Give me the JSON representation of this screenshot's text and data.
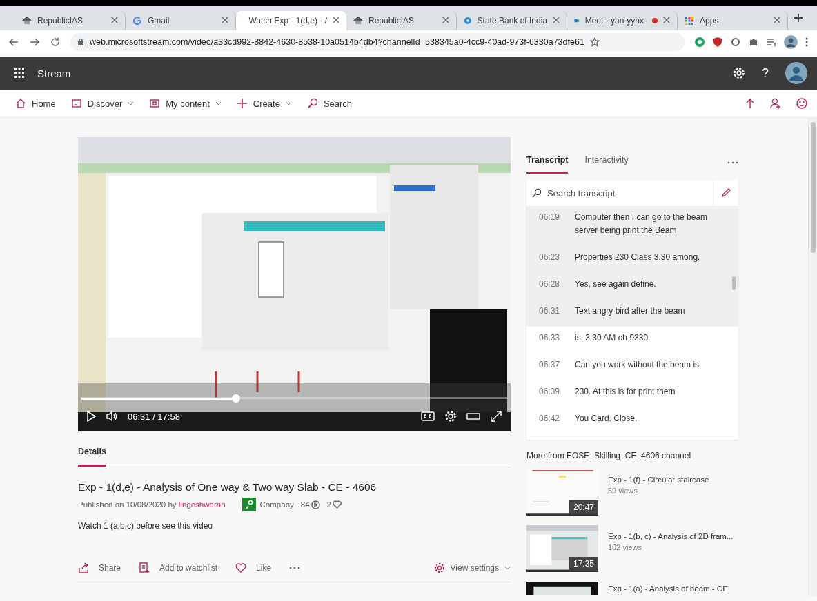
{
  "browser": {
    "tabs": [
      {
        "title": "RepublicIAS",
        "kind": "republic",
        "selected": false,
        "recording": false
      },
      {
        "title": "Gmail",
        "kind": "gmail",
        "selected": false,
        "recording": false
      },
      {
        "title": "Watch Exp - 1(d,e) - /",
        "kind": "stream",
        "selected": true,
        "recording": false
      },
      {
        "title": "RepublicIAS",
        "kind": "republic",
        "selected": false,
        "recording": false
      },
      {
        "title": "State Bank of India",
        "kind": "sbi",
        "selected": false,
        "recording": false
      },
      {
        "title": "Meet - yan-yyhx-",
        "kind": "meet",
        "selected": false,
        "recording": true
      },
      {
        "title": "Apps",
        "kind": "apps",
        "selected": false,
        "recording": false
      }
    ],
    "url": "web.microsoftstream.com/video/a33cd992-8842-4630-8538-10a0514b4db4?channelId=538345a0-4cc9-40ad-973f-6330a73dfe61"
  },
  "app": {
    "name": "Stream",
    "help": "?"
  },
  "nav": [
    {
      "label": "Home",
      "kind": "home",
      "dropdown": false
    },
    {
      "label": "Discover",
      "kind": "discover",
      "dropdown": true
    },
    {
      "label": "My content",
      "kind": "content",
      "dropdown": true
    },
    {
      "label": "Create",
      "kind": "create",
      "dropdown": true
    },
    {
      "label": "Search",
      "kind": "search",
      "dropdown": false
    }
  ],
  "player": {
    "progress": {
      "level": 0.363
    },
    "time": "06:31 / 17:58"
  },
  "transcript": {
    "tabs": [
      {
        "label": "Transcript",
        "selected": true
      },
      {
        "label": "Interactivity",
        "selected": false
      }
    ],
    "search": {
      "placeholder": "Search transcript"
    },
    "lines": [
      {
        "time": "06:19",
        "text": "Computer then I can go to the beam server being print the Beam",
        "highlighted": true
      },
      {
        "time": "06:23",
        "text": "Properties 230 Class 3.30 among.",
        "highlighted": true
      },
      {
        "time": "06:28",
        "text": "Yes, see again define.",
        "highlighted": true
      },
      {
        "time": "06:31",
        "text": "Text angry bird after the beam",
        "highlighted": true
      },
      {
        "time": "06:33",
        "text": "is. 3:30 AM oh 9330.",
        "highlighted": false
      },
      {
        "time": "06:37",
        "text": "Can you work without the beam is",
        "highlighted": false
      },
      {
        "time": "06:39",
        "text": "230. At this is for print them",
        "highlighted": false
      },
      {
        "time": "06:42",
        "text": "You Card. Close.",
        "highlighted": false
      }
    ]
  },
  "details": {
    "tabs": [
      {
        "label": "Details",
        "selected": true
      }
    ],
    "title": "Exp - 1(d,e) - Analysis of One way & Two way Slab - CE - 4606",
    "published": "Published on 10/08/2020 by",
    "author": "lingeshwaran",
    "privacy": "Company",
    "views": "84",
    "likes": "2",
    "description": "Watch 1 (a,b,c) before see this video",
    "actions": [
      {
        "label": "Share",
        "kind": "share"
      },
      {
        "label": "Add to watchlist",
        "kind": "watchlist"
      },
      {
        "label": "Like",
        "kind": "like"
      }
    ],
    "view_settings": "View settings"
  },
  "related": {
    "heading": "More from EOSE_Skilling_CE_4606 channel",
    "videos": [
      {
        "title": "Exp - 1(f) - Circular staircase",
        "views": "59 views",
        "duration": "20:47",
        "kind": "light"
      },
      {
        "title": "Exp - 1(b, c) - Analysis of 2D fram...",
        "views": "102 views",
        "duration": "17:35",
        "kind": "window"
      },
      {
        "title": "Exp - 1(a) - Analysis of beam - CE",
        "kind": "dark"
      }
    ]
  }
}
